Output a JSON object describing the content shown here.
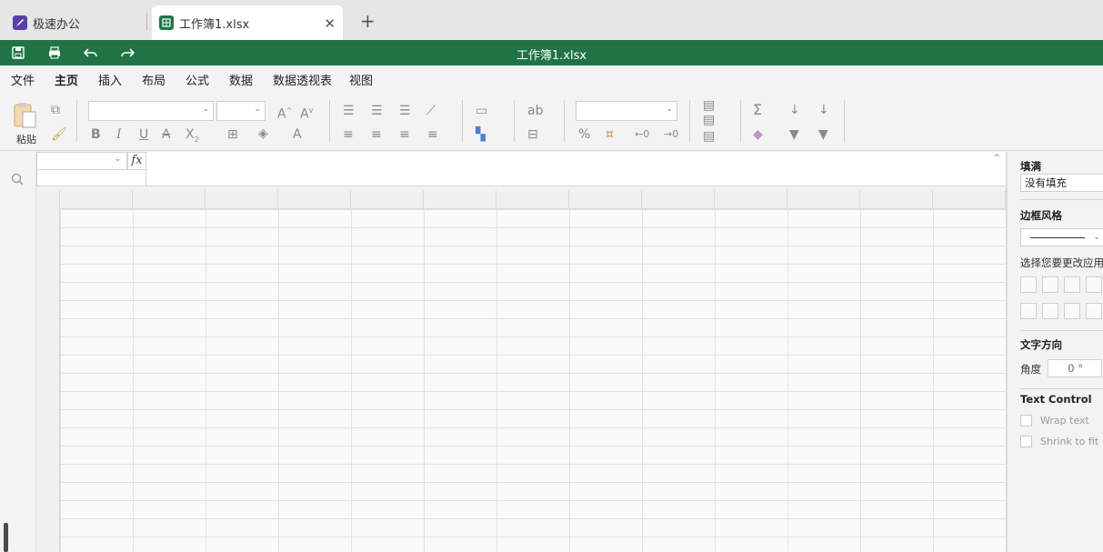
{
  "tabs": {
    "home_label": "极速办公",
    "active_label": "工作簿1.xlsx",
    "close_symbol": "✕",
    "add_symbol": "+"
  },
  "header": {
    "title": "工作簿1.xlsx",
    "accent_color": "#217346"
  },
  "menu": {
    "items": [
      "文件",
      "主页",
      "插入",
      "布局",
      "公式",
      "数据",
      "数据透视表",
      "视图"
    ],
    "active": "主页"
  },
  "ribbon": {
    "paste_label": "粘贴"
  },
  "formula": {
    "fx_label": "fx"
  },
  "right_panel": {
    "fill_title": "填满",
    "fill_value": "没有填充",
    "border_style_title": "边框风格",
    "border_select_hint": "选择您要更改应用样",
    "text_direction_title": "文字方向",
    "angle_label": "角度",
    "angle_value": "0 °",
    "text_control_title": "Text Control",
    "wrap_text_label": "Wrap text",
    "shrink_to_fit_label": "Shrink to fit"
  }
}
